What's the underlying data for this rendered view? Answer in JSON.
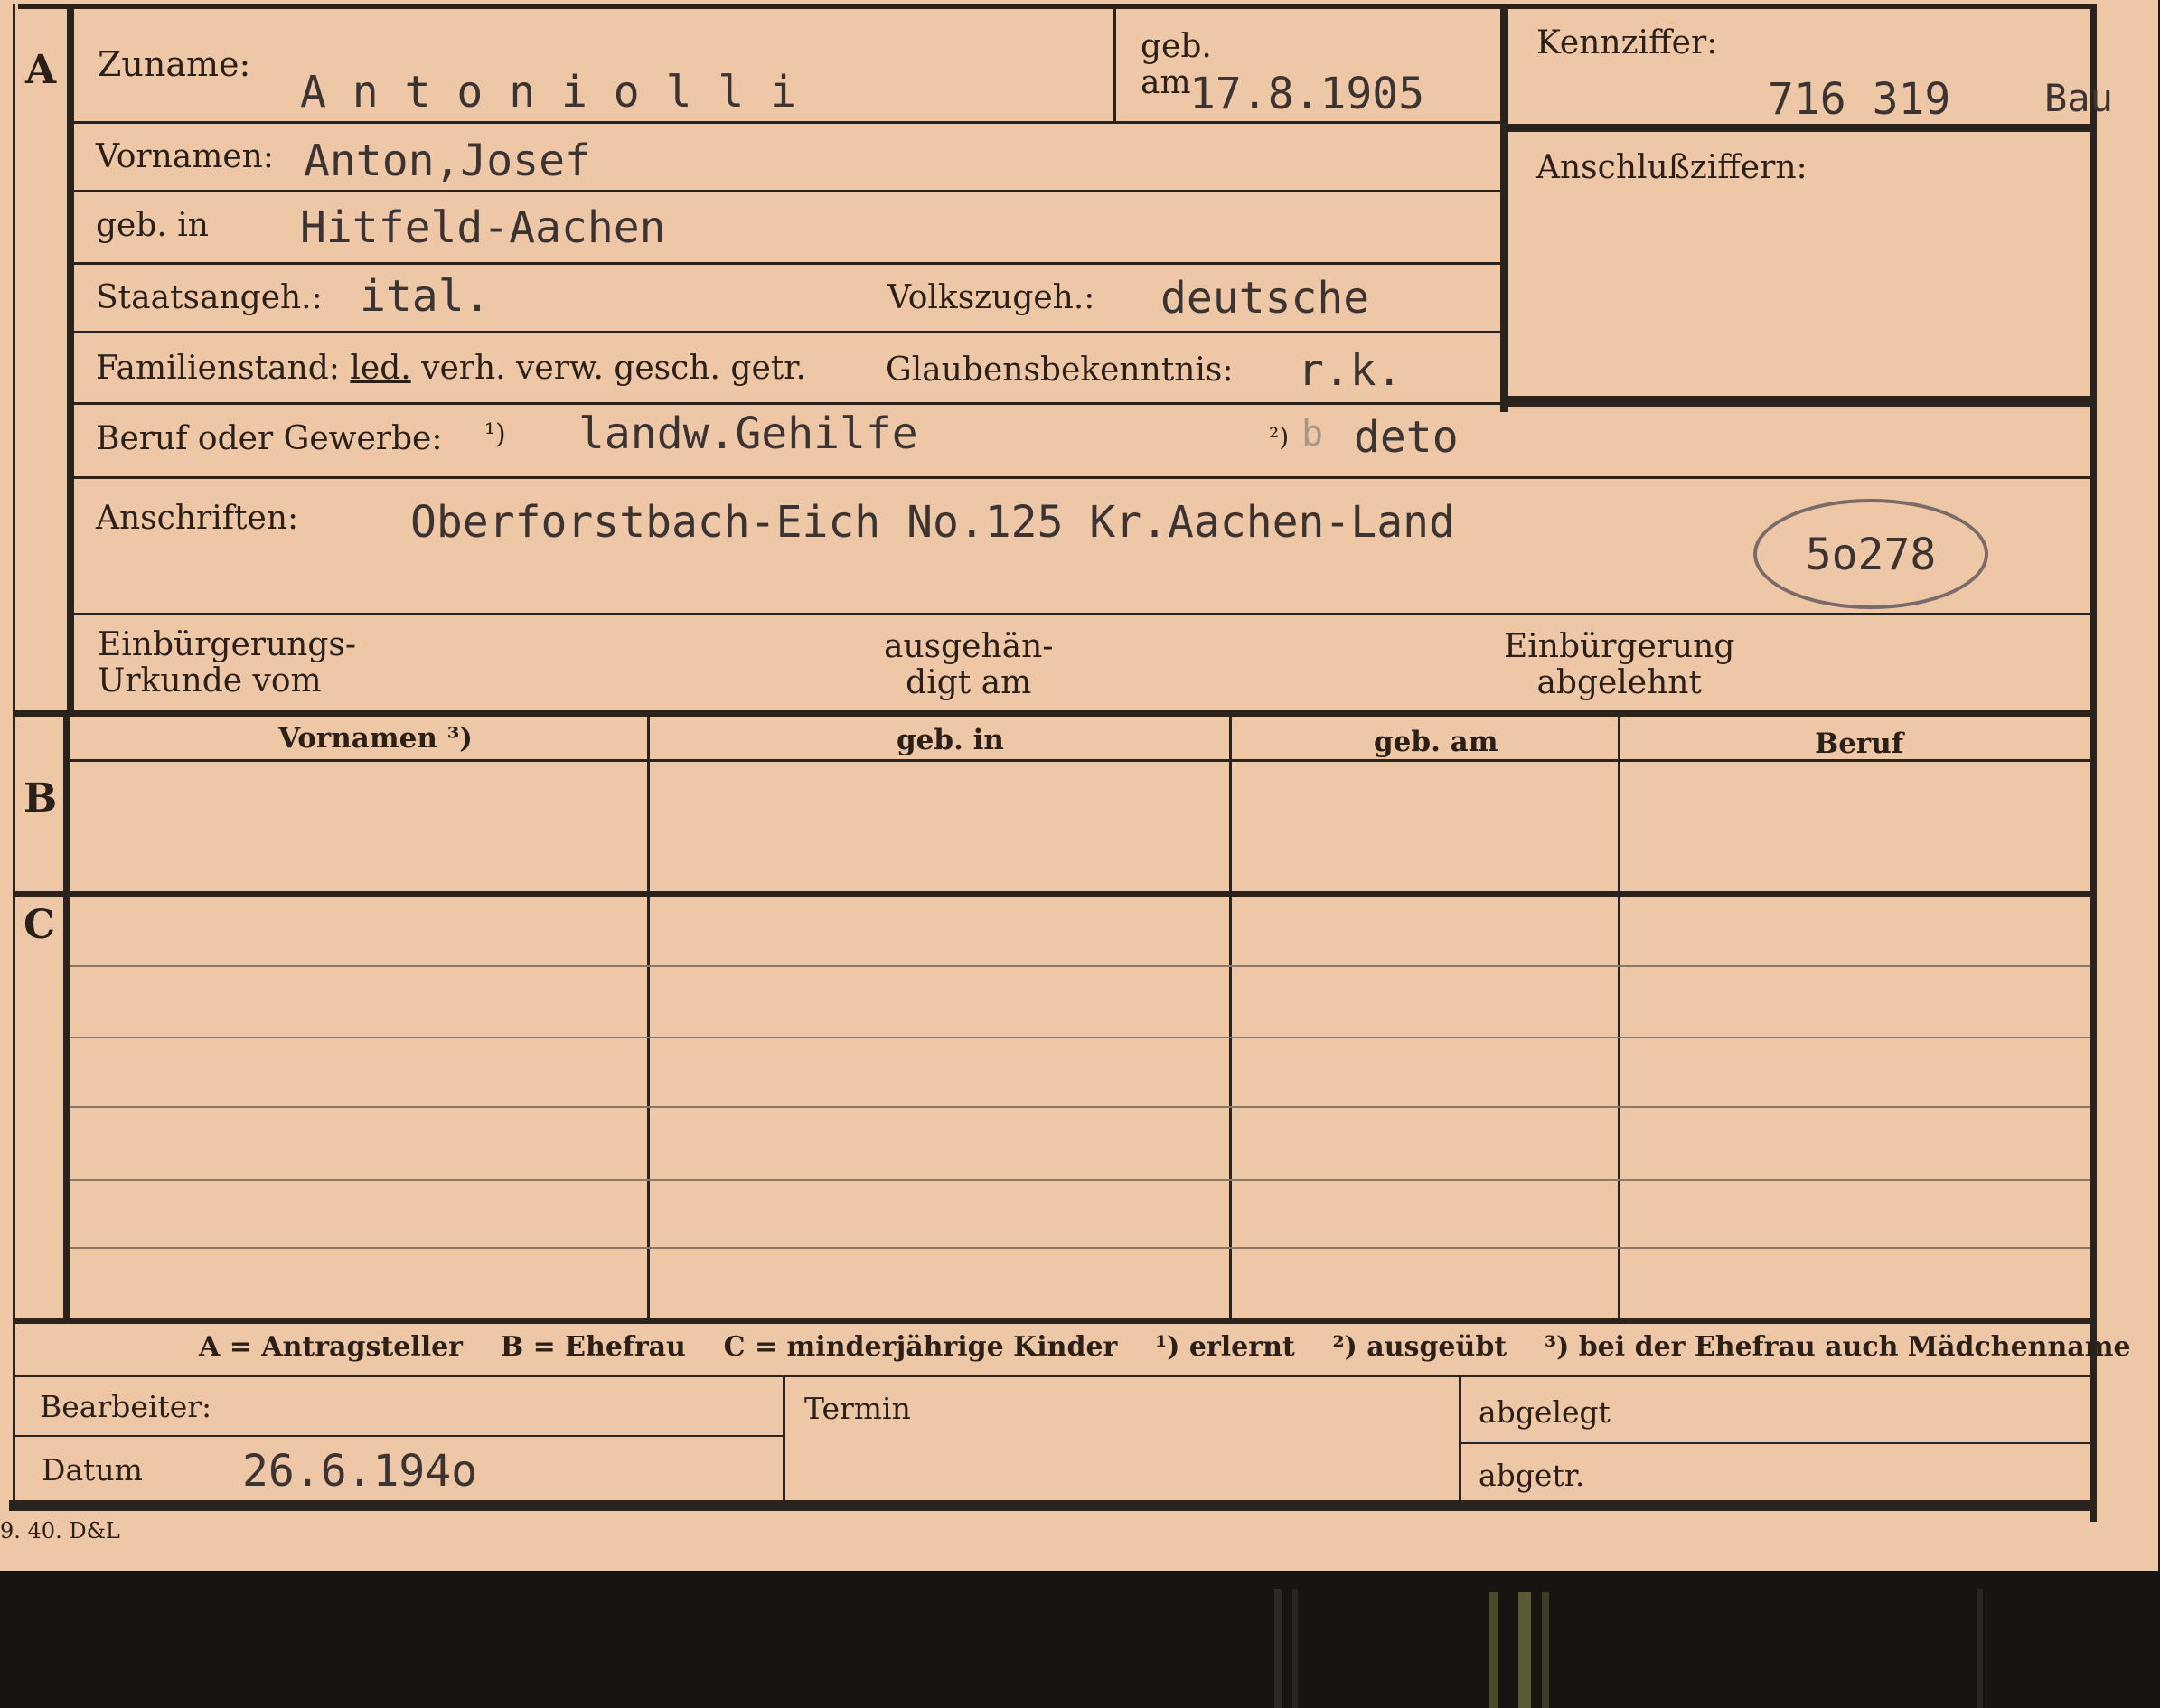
{
  "card": {
    "section_a": "A",
    "section_b": "B",
    "section_c": "C",
    "labels": {
      "zuname": "Zuname:",
      "geb_am": "geb.\nam",
      "kennziffer": "Kennziffer:",
      "vornamen": "Vornamen:",
      "anschlussziffern": "Anschlußziffern:",
      "geb_in": "geb. in",
      "staatsangeh": "Staatsangeh.:",
      "volkszugeh": "Volkszugeh.:",
      "familienstand_prefix": "Familienstand: ",
      "familienstand_underlined": "led.",
      "familienstand_rest": " verh. verw. gesch. getr.",
      "glaubensbekenntnis": "Glaubensbekenntnis:",
      "beruf_oder_gewerbe": "Beruf oder Gewerbe:",
      "note_1": "¹)",
      "note_2": "²)",
      "anschriften": "Anschriften:",
      "einbuergerungsurkunde": "Einbürgerungs-\nUrkunde vom",
      "ausgehaendigt": "ausgehän-\ndigt am",
      "einbuergerung_abgelehnt": "Einbürgerung\nabgelehnt",
      "bearbeiter": "Bearbeiter:",
      "termin": "Termin",
      "abgelegt": "abgelegt",
      "datum": "Datum",
      "abgetr": "abgetr."
    },
    "values": {
      "zuname": "A n t o n i o l l i",
      "geb_am": "17.8.1905",
      "kennziffer": "716 319",
      "kennziffer_suffix": "Bau",
      "vornamen": "Anton,Josef",
      "geb_in": "Hitfeld-Aachen",
      "staatsangeh": "ital.",
      "volkszugeh": "deutsche",
      "glaubensbekenntnis": "r.k.",
      "beruf_erlernt": "landw.Gehilfe",
      "beruf_ausgeuebt_mark": "b",
      "beruf_ausgeuebt": "deto",
      "anschrift": "Oberforstbach-Eich No.125 Kr.Aachen-Land",
      "stamp_number": "5o278",
      "datum": "26.6.194o"
    },
    "table_headers": [
      "Vornamen ³)",
      "geb. in",
      "geb. am",
      "Beruf"
    ],
    "legend": "A = Antragsteller    B = Ehefrau    C = minderjährige Kinder    ¹) erlernt    ²) ausgeübt    ³) bei der Ehefrau auch Mädchenname",
    "print_code": "9. 40. D&L"
  }
}
